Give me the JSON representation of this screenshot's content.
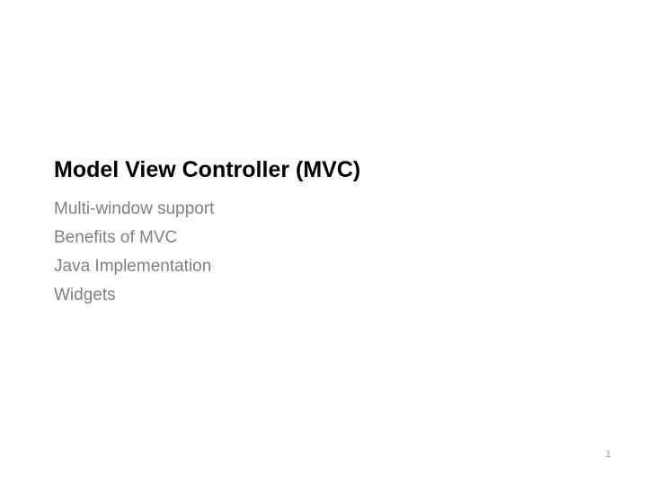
{
  "slide": {
    "title": "Model View Controller (MVC)",
    "bullets": [
      "Multi-window support",
      "Benefits of MVC",
      "Java Implementation",
      "Widgets"
    ],
    "page_number": "1"
  }
}
